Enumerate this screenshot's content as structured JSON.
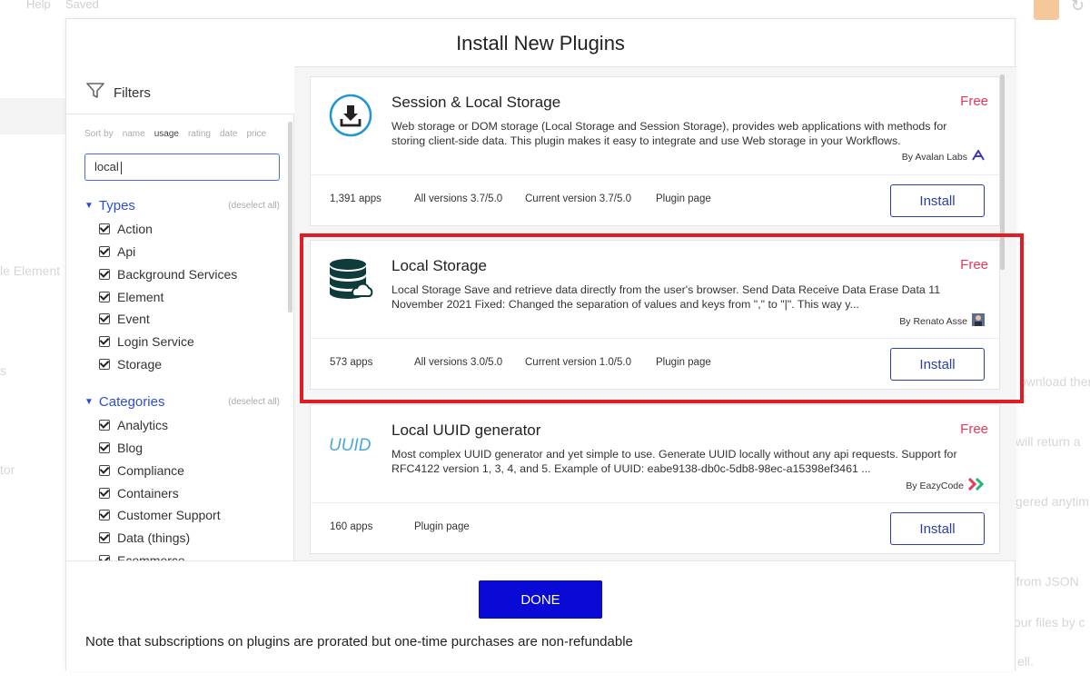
{
  "background": {
    "menu_help": "Help",
    "menu_saved": "Saved",
    "left_texts": [
      "le Element",
      "s",
      "tor"
    ],
    "right_texts": [
      "ownload ther",
      "will return a",
      "gered anytim",
      "' from JSON",
      "our files by c",
      "ell."
    ]
  },
  "modal": {
    "title": "Install New Plugins"
  },
  "filters": {
    "title": "Filters",
    "sort_label": "Sort by",
    "sort_options": [
      "name",
      "usage",
      "rating",
      "date",
      "price"
    ],
    "sort_active": "usage",
    "search_value": "local",
    "types": {
      "label": "Types",
      "deselect": "(deselect all)",
      "items": [
        "Action",
        "Api",
        "Background Services",
        "Element",
        "Event",
        "Login Service",
        "Storage"
      ]
    },
    "categories": {
      "label": "Categories",
      "deselect": "(deselect all)",
      "items": [
        "Analytics",
        "Blog",
        "Compliance",
        "Containers",
        "Customer Support",
        "Data (things)",
        "Ecommerce"
      ]
    }
  },
  "plugins": [
    {
      "name": "Session & Local Storage",
      "price": "Free",
      "description": "Web storage or DOM storage (Local Storage and Session Storage), provides web applications with methods for storing client-side data. This plugin makes it easy to integrate and use Web storage in your Workflows.",
      "author": "By Avalan Labs",
      "apps": "1,391 apps",
      "all_versions": "All versions 3.7/5.0",
      "current_version": "Current version 3.7/5.0",
      "plugin_page": "Plugin page",
      "install": "Install",
      "icon": "download-icon"
    },
    {
      "name": "Local Storage",
      "price": "Free",
      "description": "Local Storage Save and retrieve data directly from the user's browser. Send Data Receive Data Erase Data 11 November 2021 Fixed: Changed the separation of values and keys from \",\" to \"|\". This way y...",
      "author": "By Renato Asse",
      "apps": "573 apps",
      "all_versions": "All versions 3.0/5.0",
      "current_version": "Current version 1.0/5.0",
      "plugin_page": "Plugin page",
      "install": "Install",
      "icon": "database-cloud-icon"
    },
    {
      "name": "Local UUID generator",
      "price": "Free",
      "description": "Most complex UUID generator and yet simple to use. Generate UUID locally without any api requests. Support for RFC4122 version 1, 3, 4, and 5. Example of UUID: eabe9138-db0c-5db8-98ec-a15398ef3461 ...",
      "author": "By EazyCode",
      "apps": "160 apps",
      "plugin_page": "Plugin page",
      "install": "Install",
      "icon": "uuid-logo-icon"
    }
  ],
  "footer": {
    "done": "DONE",
    "note": "Note that subscriptions on plugins are prorated but one-time purchases are non-refundable"
  },
  "colors": {
    "accent": "#2b4ed6",
    "done_bg": "#0a0ad6",
    "price": "#e5395a",
    "highlight": "#e31b23"
  }
}
